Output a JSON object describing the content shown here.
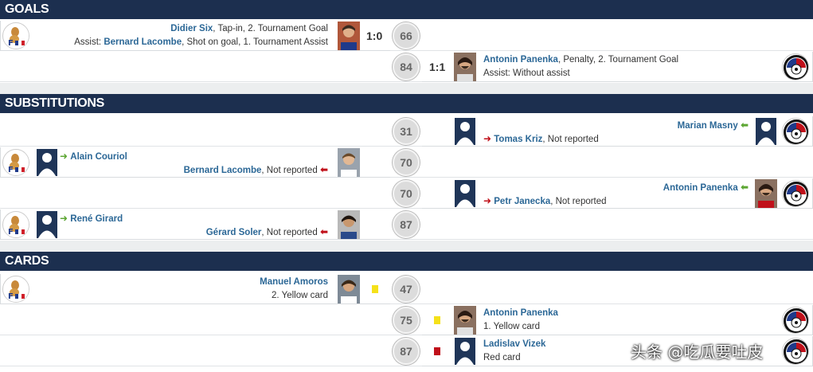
{
  "sections": {
    "goals": "GOALS",
    "substitutions": "SUBSTITUTIONS",
    "cards": "CARDS"
  },
  "goals": [
    {
      "minute": "66",
      "score": "1:0",
      "player": "Didier Six",
      "detail": ", Tap-in, 2. Tournament Goal",
      "assist_prefix": "Assist: ",
      "assist_player": "Bernard Lacombe",
      "assist_detail": ", Shot on goal, 1. Tournament Assist"
    },
    {
      "minute": "84",
      "score": "1:1",
      "player": "Antonin Panenka",
      "detail": ", Penalty, 2. Tournament Goal",
      "assist_text": "Assist: Without assist"
    }
  ],
  "substitutions": [
    {
      "minute": "31",
      "player_in": "Marian Masny",
      "player_out": "Tomas Kriz",
      "out_note": ", Not reported"
    },
    {
      "minute": "70",
      "player_in": "Alain Couriol",
      "player_out": "Bernard Lacombe",
      "out_note": ", Not reported"
    },
    {
      "minute": "70",
      "player_in": "Antonin Panenka",
      "player_out": "Petr Janecka",
      "out_note": ", Not reported"
    },
    {
      "minute": "87",
      "player_in": "René Girard",
      "player_out": "Gérard Soler",
      "out_note": ", Not reported"
    }
  ],
  "cards": [
    {
      "minute": "47",
      "player": "Manuel Amoros",
      "detail": "2. Yellow card",
      "card_color": "#f5e11a"
    },
    {
      "minute": "75",
      "player": "Antonin Panenka",
      "detail": "1. Yellow card",
      "card_color": "#f5e11a"
    },
    {
      "minute": "87",
      "player": "Ladislav Vizek",
      "detail": "Red card",
      "card_color": "#c0101a"
    }
  ],
  "watermark": "头条 @吃瓜要吐皮",
  "colors": {
    "header_bg": "#1c2f4f",
    "name_link": "#2b6796",
    "sub_in": "#5ca632",
    "sub_out": "#c0101a"
  }
}
